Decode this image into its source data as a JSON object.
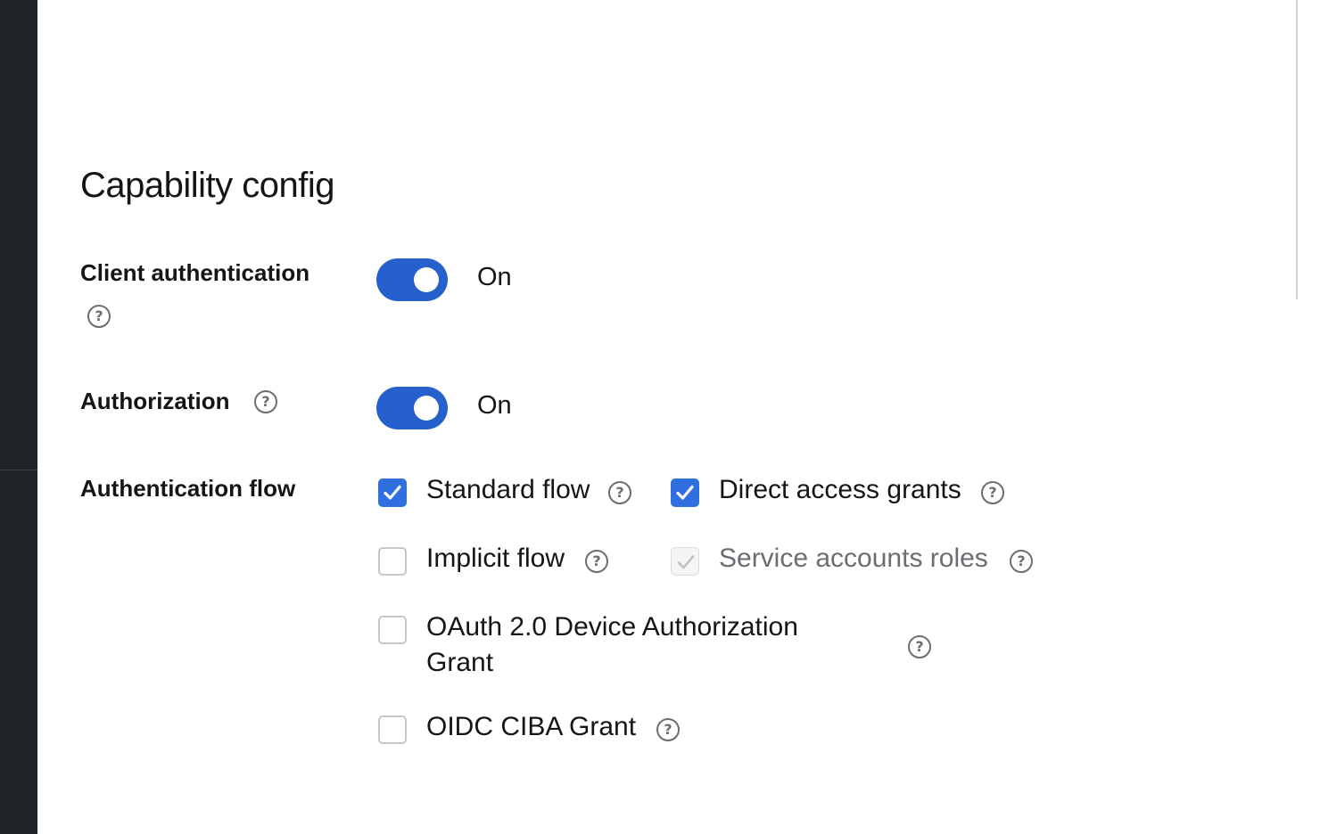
{
  "page": {
    "title": "Capability config"
  },
  "fields": {
    "client_auth": {
      "label": "Client authentication",
      "state_label": "On",
      "value": true
    },
    "authorization": {
      "label": "Authorization",
      "state_label": "On",
      "value": true
    },
    "auth_flow": {
      "label": "Authentication flow",
      "options": {
        "standard": {
          "label": "Standard flow",
          "checked": true,
          "disabled": false
        },
        "direct": {
          "label": "Direct access grants",
          "checked": true,
          "disabled": false
        },
        "implicit": {
          "label": "Implicit flow",
          "checked": false,
          "disabled": false
        },
        "service": {
          "label": "Service accounts roles",
          "checked": true,
          "disabled": true
        },
        "device_line1": "OAuth 2.0 Device Authorization",
        "device_line2": "Grant",
        "device": {
          "checked": false,
          "disabled": false
        },
        "ciba": {
          "label": "OIDC CIBA Grant",
          "checked": false,
          "disabled": false
        }
      }
    }
  },
  "icons": {
    "help_glyph": "?",
    "help": "help-icon",
    "check": "check-icon"
  },
  "colors": {
    "accent": "#2560cc",
    "checkbox_checked": "#2f6fe0",
    "sidebar": "#212427",
    "muted": "#6a6e73"
  }
}
